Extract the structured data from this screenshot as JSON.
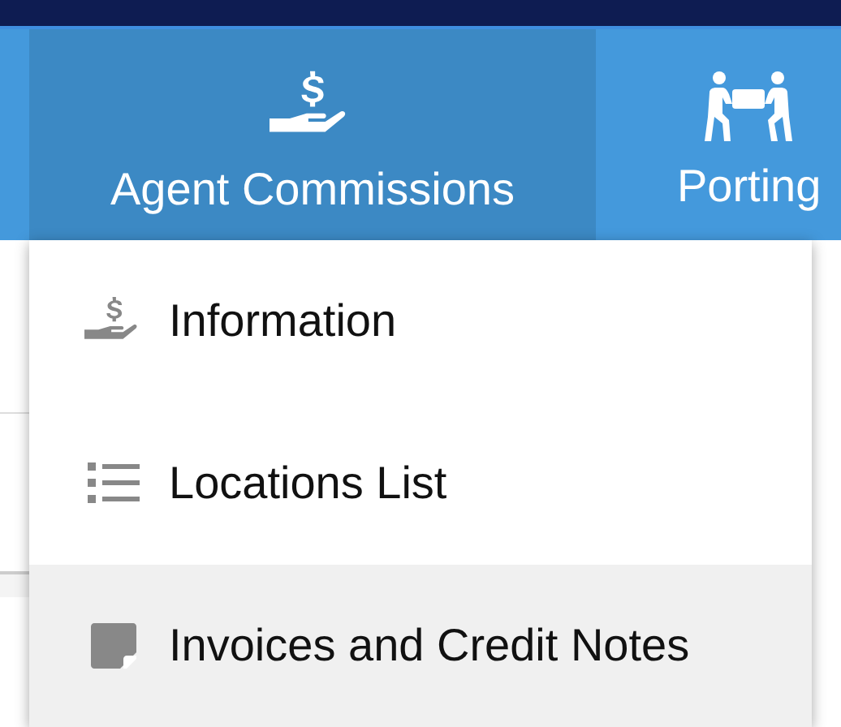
{
  "nav": {
    "tabs": [
      {
        "label": "Agent Commissions",
        "selected": true
      },
      {
        "label": "Porting",
        "selected": false
      }
    ]
  },
  "menu": {
    "items": [
      {
        "label": "Information",
        "selected": false
      },
      {
        "label": "Locations List",
        "selected": false
      },
      {
        "label": "Invoices and Credit Notes",
        "selected": true
      }
    ]
  }
}
